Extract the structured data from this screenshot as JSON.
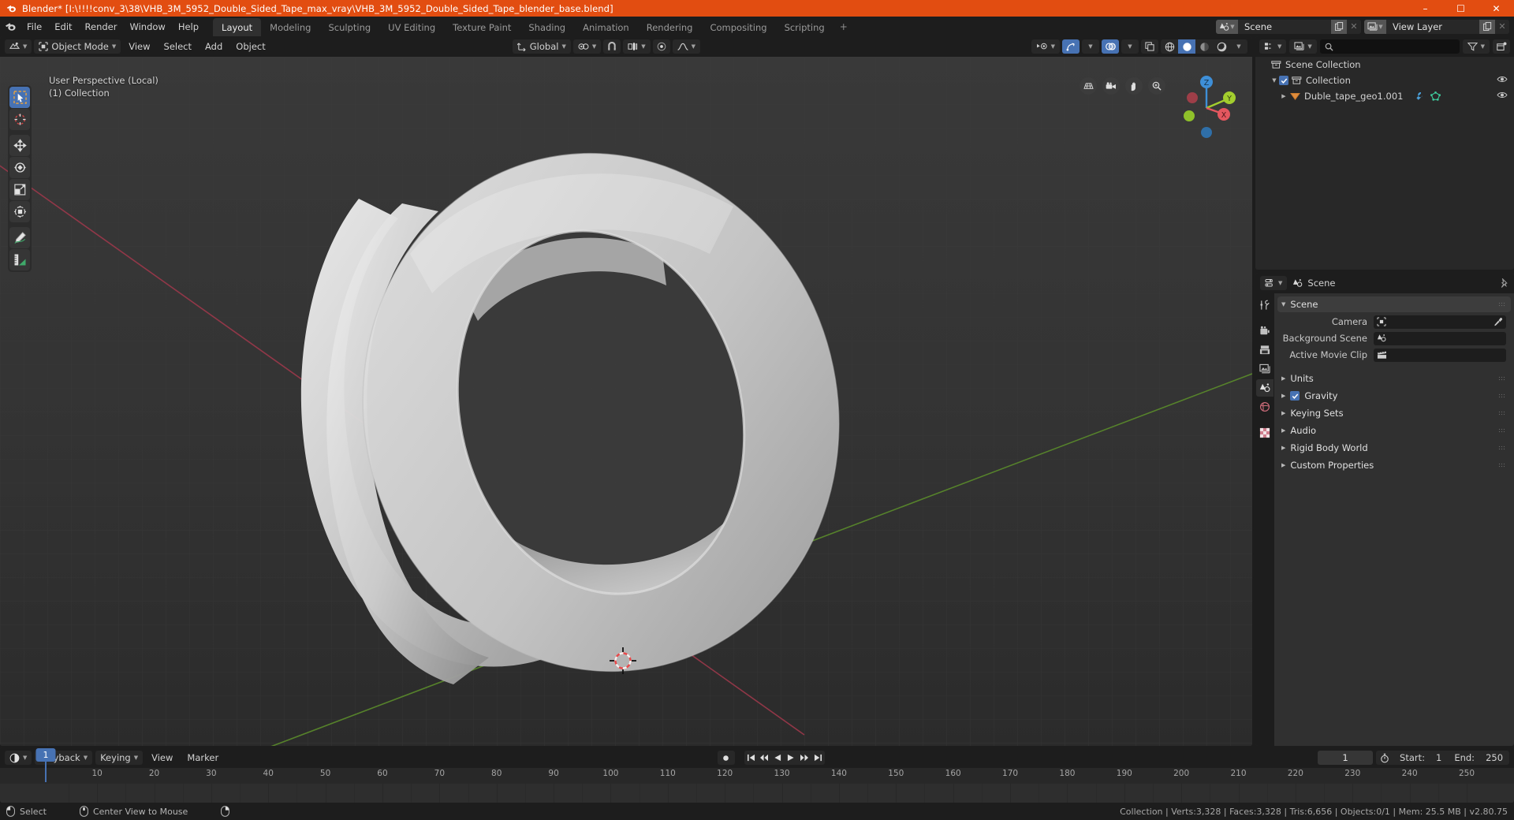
{
  "titlebar": {
    "icon": "blender-logo-icon",
    "title": "Blender* [I:\\!!!!conv_3\\38\\VHB_3M_5952_Double_Sided_Tape_max_vray\\VHB_3M_5952_Double_Sided_Tape_blender_base.blend]",
    "minimize": "–",
    "maximize": "☐",
    "close": "✕",
    "bg": "#e24d11"
  },
  "topbar": {
    "menus": [
      "File",
      "Edit",
      "Render",
      "Window",
      "Help"
    ],
    "workspaces": [
      {
        "label": "Layout",
        "active": true
      },
      {
        "label": "Modeling",
        "active": false
      },
      {
        "label": "Sculpting",
        "active": false
      },
      {
        "label": "UV Editing",
        "active": false
      },
      {
        "label": "Texture Paint",
        "active": false
      },
      {
        "label": "Shading",
        "active": false
      },
      {
        "label": "Animation",
        "active": false
      },
      {
        "label": "Rendering",
        "active": false
      },
      {
        "label": "Compositing",
        "active": false
      },
      {
        "label": "Scripting",
        "active": false
      }
    ],
    "add_workspace": "+",
    "scene": {
      "name": "Scene",
      "icon": "scene-icon",
      "new_icon": "duplicate-icon",
      "unlink": "✕"
    },
    "view_layer": {
      "name": "View Layer",
      "icon": "view-layer-icon",
      "new_icon": "duplicate-icon",
      "unlink": "✕"
    }
  },
  "viewport": {
    "header": {
      "editor_type_icon": "editor-type-3dview-icon",
      "mode": "Object Mode",
      "mode_icon": "object-mode-icon",
      "menus": [
        "View",
        "Select",
        "Add",
        "Object"
      ],
      "transform_orientation": "Global",
      "orientation_icon": "orientation-icon",
      "snap_icon": "magnet-icon",
      "snap_target_icon": "snap-increment-icon",
      "proportional_icon": "proportional-edit-icon",
      "falloff_icon": "smooth-falloff-icon",
      "visibility_icon": "visibility-selectability-icon",
      "gizmo_icon": "gizmo-icon",
      "overlay_icon": "overlays-icon",
      "xray_icon": "xray-toggle-icon",
      "shading_modes": [
        "wireframe",
        "solid",
        "material-preview",
        "rendered"
      ],
      "shading_active": "solid"
    },
    "overlay_text": [
      "User Perspective (Local)",
      "(1) Collection"
    ],
    "toolbar": [
      {
        "name": "tweak-select-box-tool",
        "active": true
      },
      {
        "name": "cursor-tool",
        "active": false
      },
      {
        "name": "move-tool",
        "active": false
      },
      {
        "name": "rotate-tool",
        "active": false
      },
      {
        "name": "scale-tool",
        "active": false
      },
      {
        "name": "transform-tool",
        "active": false
      },
      {
        "name": "annotate-tool",
        "active": false
      },
      {
        "name": "measure-tool",
        "active": false
      }
    ],
    "nav_icons": [
      "zoom-region-icon",
      "camera-view-icon",
      "move-view-icon",
      "zoom-view-icon"
    ],
    "gizmo_axes": [
      {
        "label": "X",
        "color": "#e4575f"
      },
      {
        "label": "Y",
        "color": "#a3ce2e"
      },
      {
        "label": "Z",
        "color": "#3e8fd8"
      }
    ],
    "colors": {
      "object": "#c9c9c9",
      "grid": "#3a3a3a",
      "x_axis": "#99384a",
      "y_axis": "#5a8a2b",
      "background": "#303030"
    }
  },
  "outliner": {
    "header": {
      "display_mode_icon": "outliner-display-mode-icon",
      "filter_id_icon": "filter-id-icon",
      "search_icon": "search-icon",
      "search_placeholder": "",
      "filter_icon": "funnel-icon",
      "new_collection_icon": "new-collection-icon"
    },
    "rows": [
      {
        "label": "Scene Collection",
        "indent": 0,
        "icon": "collection-icon",
        "disclosure": "",
        "checkbox": false,
        "eye": false,
        "extra": []
      },
      {
        "label": "Collection",
        "indent": 1,
        "icon": "collection-icon",
        "disclosure": "▼",
        "checkbox": true,
        "eye": true,
        "extra": []
      },
      {
        "label": "Duble_tape_geo1.001",
        "indent": 2,
        "icon": "mesh-object-icon",
        "disclosure": "▶",
        "checkbox": false,
        "eye": true,
        "extra": [
          "modifier-wrench-icon",
          "mesh-data-icon"
        ]
      }
    ]
  },
  "properties": {
    "header": {
      "editor_type_icon": "editor-type-properties-icon",
      "breadcrumb_icon": "scene-icon",
      "breadcrumb": "Scene",
      "pin_icon": "pin-icon"
    },
    "tabs": [
      {
        "name": "tool-tab",
        "active": false
      },
      {
        "name": "render-tab",
        "active": false
      },
      {
        "name": "output-tab",
        "active": false
      },
      {
        "name": "view-layer-tab",
        "active": false
      },
      {
        "name": "scene-tab",
        "active": true
      },
      {
        "name": "world-tab",
        "active": false
      },
      {
        "name": "texture-tab",
        "active": false
      }
    ],
    "scene_panel": {
      "title": "Scene",
      "open": true,
      "fields": [
        {
          "label": "Camera",
          "value": "",
          "icon": "camera-data-icon",
          "eyedropper": true
        },
        {
          "label": "Background Scene",
          "value": "",
          "icon": "scene-icon",
          "eyedropper": false
        },
        {
          "label": "Active Movie Clip",
          "value": "",
          "icon": "movie-clip-icon",
          "eyedropper": false
        }
      ]
    },
    "panels": [
      {
        "title": "Units",
        "open": false,
        "checkbox": null
      },
      {
        "title": "Gravity",
        "open": false,
        "checkbox": true
      },
      {
        "title": "Keying Sets",
        "open": false,
        "checkbox": null
      },
      {
        "title": "Audio",
        "open": false,
        "checkbox": null
      },
      {
        "title": "Rigid Body World",
        "open": false,
        "checkbox": null
      },
      {
        "title": "Custom Properties",
        "open": false,
        "checkbox": null
      }
    ]
  },
  "timeline": {
    "header": {
      "editor_type_icon": "editor-type-timeline-icon",
      "menus": [
        {
          "label": "Playback",
          "dropdown": true
        },
        {
          "label": "Keying",
          "dropdown": true
        },
        {
          "label": "View",
          "dropdown": false
        },
        {
          "label": "Marker",
          "dropdown": false
        }
      ],
      "record_icon": "auto-keying-record-icon",
      "transport": [
        "jump-to-start-icon",
        "prev-keyframe-icon",
        "play-reverse-icon",
        "play-icon",
        "next-keyframe-icon",
        "jump-to-end-icon"
      ],
      "current_frame": "1",
      "use_preview_range_icon": "stopwatch-icon",
      "start_label": "Start:",
      "start_value": "1",
      "end_label": "End:",
      "end_value": "250"
    },
    "playhead": "1",
    "ticks": [
      10,
      20,
      30,
      40,
      50,
      60,
      70,
      80,
      90,
      100,
      110,
      120,
      130,
      140,
      150,
      160,
      170,
      180,
      190,
      200,
      210,
      220,
      230,
      240,
      250
    ],
    "frame_start": 1,
    "frame_end": 250
  },
  "statusbar": {
    "items": [
      {
        "icon": "mouse-left-icon",
        "label": "Select"
      },
      {
        "icon": "mouse-middle-icon",
        "label": "Center View to Mouse"
      },
      {
        "icon": "mouse-right-icon",
        "label": ""
      }
    ],
    "stats": "Collection | Verts:3,328 | Faces:3,328 | Tris:6,656 | Objects:0/1 | Mem: 25.5 MB | v2.80.75"
  }
}
